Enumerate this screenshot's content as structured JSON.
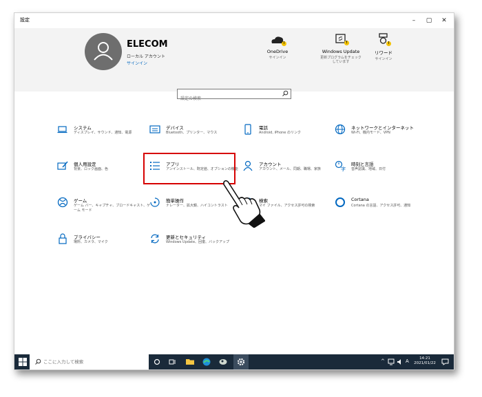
{
  "window": {
    "title": "設定",
    "minimize": "–",
    "maximize": "▢",
    "close": "✕"
  },
  "user": {
    "name": "ELECOM",
    "account_type": "ローカル アカウント",
    "signin": "サインイン"
  },
  "header_items": [
    {
      "label": "OneDrive",
      "sub1": "サインイン",
      "sub2": ""
    },
    {
      "label": "Windows Update",
      "sub1": "更新プログラムをチェック",
      "sub2": "しています"
    },
    {
      "label": "リワード",
      "sub1": "サインイン",
      "sub2": ""
    }
  ],
  "search": {
    "placeholder": "設定の検索"
  },
  "categories": [
    {
      "title": "システム",
      "desc": "ディスプレイ、サウンド、通知、電源"
    },
    {
      "title": "デバイス",
      "desc": "Bluetooth、プリンター、マウス"
    },
    {
      "title": "電話",
      "desc": "Android, iPhone のリンク"
    },
    {
      "title": "ネットワークとインターネット",
      "desc": "Wi-Fi、機内モード、VPN"
    },
    {
      "title": "個人用設定",
      "desc": "背景、ロック画面、色"
    },
    {
      "title": "アプリ",
      "desc": "アンインストール、既定値、オプションの機能"
    },
    {
      "title": "アカウント",
      "desc": "アカウント、メール、同期、職場、家族"
    },
    {
      "title": "時刻と言語",
      "desc": "音声認識、地域、日付"
    },
    {
      "title": "ゲーム",
      "desc": "ゲーム バー、キャプチャ、ブロードキャスト、ゲーム モード"
    },
    {
      "title": "簡単操作",
      "desc": "ナレーター、拡大鏡、ハイコントラスト"
    },
    {
      "title": "検索",
      "desc": "マイ ファイル、アクセス許可の検索"
    },
    {
      "title": "Cortana",
      "desc": "Cortana の言語、アクセス許可、通知"
    },
    {
      "title": "プライバシー",
      "desc": "場所、カメラ、マイク"
    },
    {
      "title": "更新とセキュリティ",
      "desc": "Windows Update、回復、バックアップ"
    }
  ],
  "taskbar": {
    "search_placeholder": "ここに入力して検索",
    "ime": "A",
    "time": "14:21",
    "date": "2021/01/22"
  },
  "colors": {
    "accent": "#0067c0",
    "highlight_box": "#d60000",
    "taskbar": "#1a2a3a",
    "header_bg": "#f3f3f3"
  }
}
